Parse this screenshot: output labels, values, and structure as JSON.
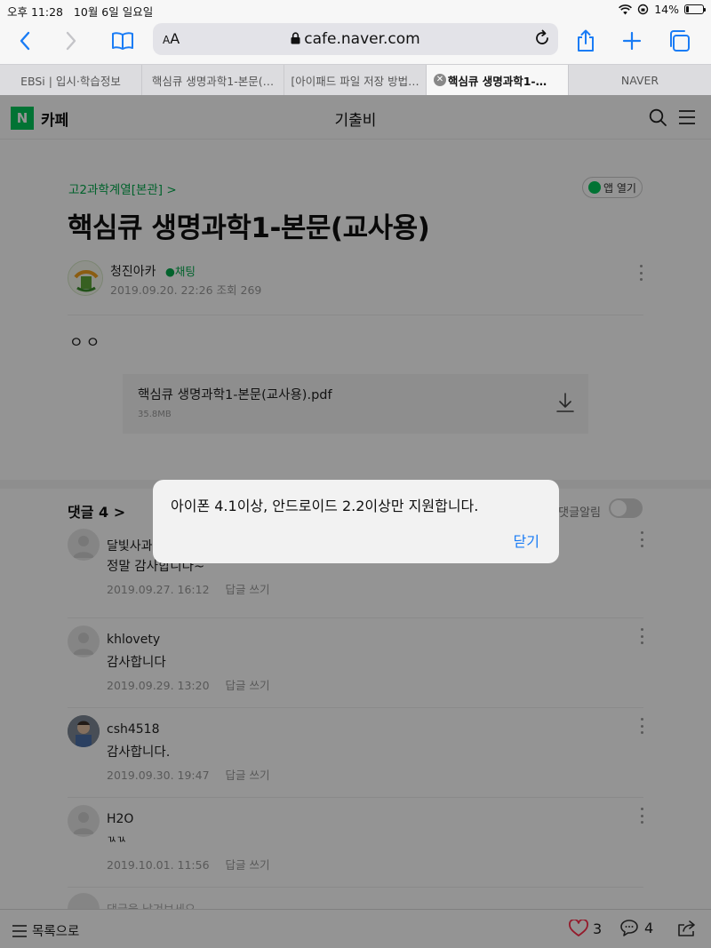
{
  "status_bar": {
    "time": "오후 11:28",
    "date": "10월 6일 일요일",
    "battery": "14%",
    "battery_level": 0.14
  },
  "browser": {
    "aa_label": "AA",
    "url": "cafe.naver.com",
    "icons": [
      "back-icon",
      "forward-icon",
      "bookmarks-icon",
      "lock-icon",
      "reload-icon",
      "share-icon",
      "new-tab-icon",
      "tabs-icon"
    ],
    "accent": "#1a7cf5"
  },
  "tabs": [
    {
      "label": "EBSi | 입시·학습정보"
    },
    {
      "label": "핵심큐 생명과학1-본문(…"
    },
    {
      "label": "[아이패드 파일 저장 방법…"
    },
    {
      "label": "핵심큐 생명과학1-…"
    },
    {
      "label": "NAVER"
    }
  ],
  "cafe": {
    "logo": "N",
    "name": "카페",
    "title": "기출비",
    "brand_color": "#03c75a"
  },
  "post": {
    "board": "고2과학계열[본관] >",
    "app_open": "앱 열기",
    "title": "핵심큐 생명과학1-본문(교사용)",
    "author": "청진아카",
    "chat": "채팅",
    "meta": "2019.09.20. 22:26   조회 269",
    "body": "ㅇㅇ",
    "attachment": {
      "name": "핵심큐 생명과학1-본문(교사용).pdf",
      "size": "35.8MB"
    }
  },
  "comments_section": {
    "header": "댓글 4 >",
    "alarm": "댓글알림",
    "reply_label": "답글 쓰기",
    "items": [
      {
        "name": "달빛사과",
        "text": "정말 감사합니다~",
        "date": "2019.09.27. 16:12"
      },
      {
        "name": "khlovety",
        "text": "감사합니다",
        "date": "2019.09.29. 13:20"
      },
      {
        "name": "csh4518",
        "text": "감사합니다.",
        "date": "2019.09.30. 19:47"
      },
      {
        "name": "H2O",
        "text": "ㄳㄳ",
        "date": "2019.10.01. 11:56"
      }
    ],
    "write_hint": "댓글을 남겨보세요"
  },
  "bottom_bar": {
    "list": "목록으로",
    "likes": "3",
    "comments": "4"
  },
  "alert": {
    "message": "아이폰 4.1이상, 안드로이드 2.2이상만 지원합니다.",
    "close": "닫기"
  }
}
